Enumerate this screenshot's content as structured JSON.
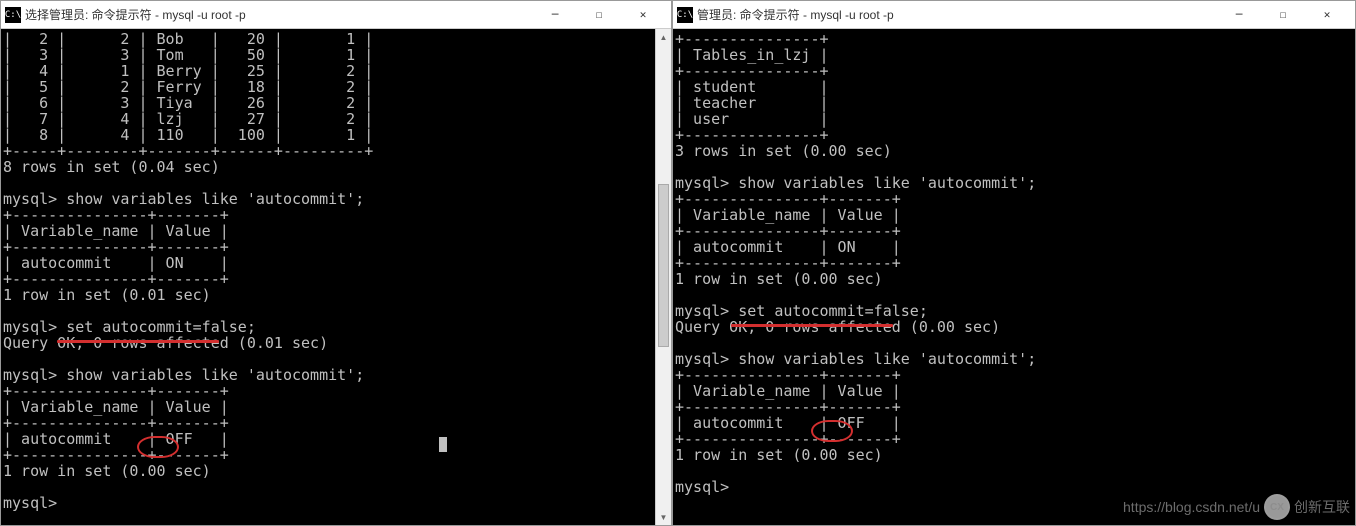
{
  "left_window": {
    "title": "选择管理员: 命令提示符 - mysql  -u root -p",
    "icon_text": "C:\\",
    "terminal_lines": [
      "|   2 |      2 | Bob   |   20 |       1 |",
      "|   3 |      3 | Tom   |   50 |       1 |",
      "|   4 |      1 | Berry |   25 |       2 |",
      "|   5 |      2 | Ferry |   18 |       2 |",
      "|   6 |      3 | Tiya  |   26 |       2 |",
      "|   7 |      4 | lzj   |   27 |       2 |",
      "|   8 |      4 | 110   |  100 |       1 |",
      "+-----+--------+-------+------+---------+",
      "8 rows in set (0.04 sec)",
      "",
      "mysql> show variables like 'autocommit';",
      "+---------------+-------+",
      "| Variable_name | Value |",
      "+---------------+-------+",
      "| autocommit    | ON    |",
      "+---------------+-------+",
      "1 row in set (0.01 sec)",
      "",
      "mysql> set autocommit=false;",
      "Query OK, 0 rows affected (0.01 sec)",
      "",
      "mysql> show variables like 'autocommit';",
      "+---------------+-------+",
      "| Variable_name | Value |",
      "+---------------+-------+",
      "| autocommit    | OFF   |",
      "+---------------+-------+",
      "1 row in set (0.00 sec)",
      "",
      "mysql>"
    ]
  },
  "right_window": {
    "title": "管理员: 命令提示符 - mysql  -u root -p",
    "icon_text": "C:\\",
    "terminal_lines": [
      "+---------------+",
      "| Tables_in_lzj |",
      "+---------------+",
      "| student       |",
      "| teacher       |",
      "| user          |",
      "+---------------+",
      "3 rows in set (0.00 sec)",
      "",
      "mysql> show variables like 'autocommit';",
      "+---------------+-------+",
      "| Variable_name | Value |",
      "+---------------+-------+",
      "| autocommit    | ON    |",
      "+---------------+-------+",
      "1 row in set (0.00 sec)",
      "",
      "mysql> set autocommit=false;",
      "Query OK, 0 rows affected (0.00 sec)",
      "",
      "mysql> show variables like 'autocommit';",
      "+---------------+-------+",
      "| Variable_name | Value |",
      "+---------------+-------+",
      "| autocommit    | OFF   |",
      "+---------------+-------+",
      "1 row in set (0.00 sec)",
      "",
      "mysql>"
    ]
  },
  "controls": {
    "minimize": "─",
    "maximize": "☐",
    "close": "✕"
  },
  "watermark": {
    "url": "https://blog.csdn.net/u",
    "logo1": "CX",
    "logo2": "创新互联"
  }
}
